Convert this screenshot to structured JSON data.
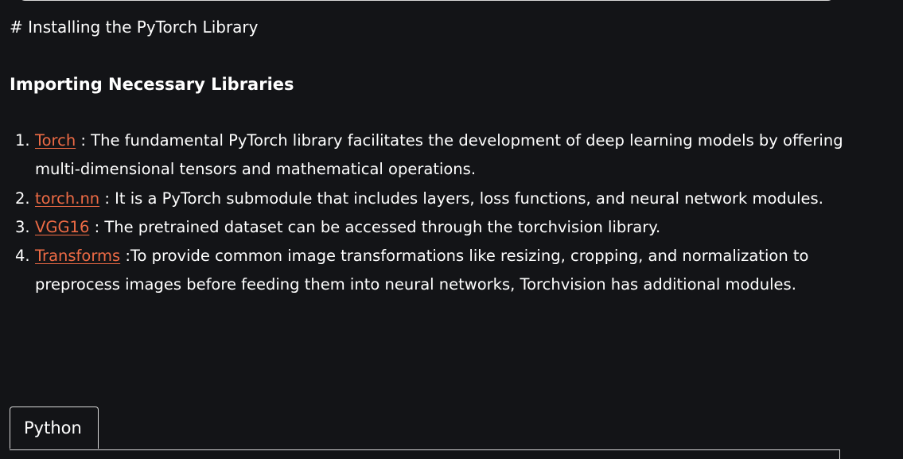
{
  "article": {
    "comment_heading": "# Installing the PyTorch Library",
    "section_title": "Importing Necessary Libraries",
    "libraries": [
      {
        "num": "1.",
        "link": "Torch",
        "text": " : The fundamental PyTorch library facilitates the development of deep learning models by offering multi-dimensional tensors and mathematical operations."
      },
      {
        "num": "2.",
        "link": "torch.nn",
        "text": " : It is a PyTorch submodule that includes layers, loss functions, and neural network modules."
      },
      {
        "num": "3.",
        "link": "VGG16",
        "text": " : The pretrained dataset can be accessed through the torchvision library."
      },
      {
        "num": "4.",
        "link": "Transforms",
        "text": " :To provide common image transformations like resizing, cropping, and normalization to preprocess images before feeding them into neural networks, Torchvision has additional modules."
      }
    ]
  },
  "code_block": {
    "tab_label": "Python"
  },
  "colors": {
    "background": "#131417",
    "text": "#ffffff",
    "link": "#ee6b45",
    "border": "#d8d8d8"
  }
}
